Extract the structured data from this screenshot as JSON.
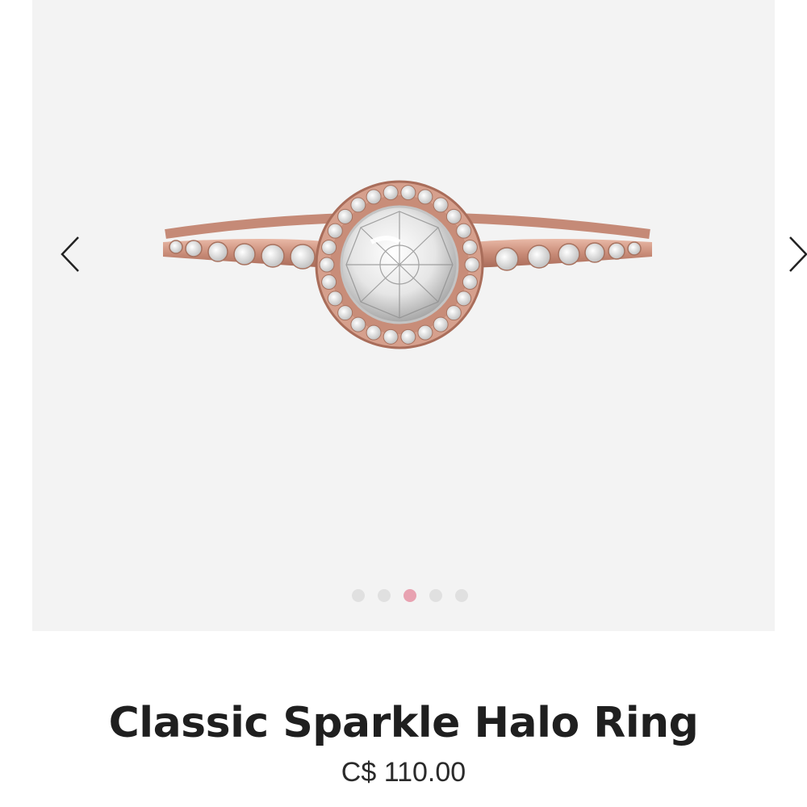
{
  "product": {
    "title": "Classic Sparkle Halo Ring",
    "price": "C$ 110.00"
  },
  "gallery": {
    "image_count": 5,
    "active_index": 2,
    "prev_icon": "chevron-left-icon",
    "next_icon": "chevron-right-icon"
  },
  "colors": {
    "gallery_bg": "#f3f3f3",
    "rose_gold": "#d39a87",
    "dot_active": "#e8a2b1",
    "dot_inactive": "#e0e0e0",
    "title_text": "#1f1f1f"
  }
}
